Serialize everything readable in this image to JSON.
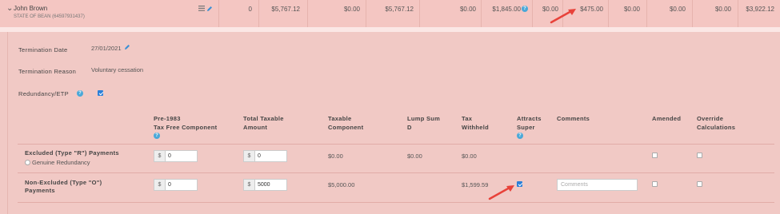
{
  "employee": {
    "name": "John Brown",
    "subtitle": "STATE OF BEAN (64597931437)",
    "amounts": [
      "0",
      "$5,767.12",
      "$0.00",
      "$5,767.12",
      "$0.00",
      "$1,845.00",
      "$0.00",
      "$475.00",
      "$0.00",
      "$0.00",
      "$0.00",
      "$3,922.12"
    ]
  },
  "details": {
    "termination_date_label": "Termination Date",
    "termination_date": "27/01/2021",
    "termination_reason_label": "Termination Reason",
    "termination_reason": "Voluntary cessation",
    "redundancy_label": "Redundancy/ETP"
  },
  "table": {
    "headers": {
      "pre1983": "Pre-1983\nTax Free Component",
      "total_taxable": "Total Taxable\nAmount",
      "taxable_component": "Taxable\nComponent",
      "lump_sum_d": "Lump Sum\nD",
      "tax_withheld": "Tax\nWithheld",
      "attracts_super": "Attracts\nSuper",
      "comments": "Comments",
      "amended": "Amended",
      "override": "Override\nCalculations"
    },
    "currency_symbol": "$",
    "rows": [
      {
        "label": "Excluded (Type \"R\") Payments",
        "sublabel": "Genuine Redundancy",
        "pre1983": "0",
        "total_taxable": "0",
        "taxable_component": "$0.00",
        "lump_sum_d": "$0.00",
        "tax_withheld": "$0.00",
        "attracts_super": null,
        "comments_placeholder": null
      },
      {
        "label": "Non-Excluded (Type \"O\")\nPayments",
        "sublabel": null,
        "pre1983": "0",
        "total_taxable": "5000",
        "taxable_component": "$5,000.00",
        "lump_sum_d": null,
        "tax_withheld": "$1,599.59",
        "attracts_super": true,
        "comments_placeholder": "Comments"
      }
    ]
  },
  "colors": {
    "background": "#f1c9c5",
    "accent_blue": "#2b7fd8",
    "annotation_arrow": "#e8423a"
  }
}
